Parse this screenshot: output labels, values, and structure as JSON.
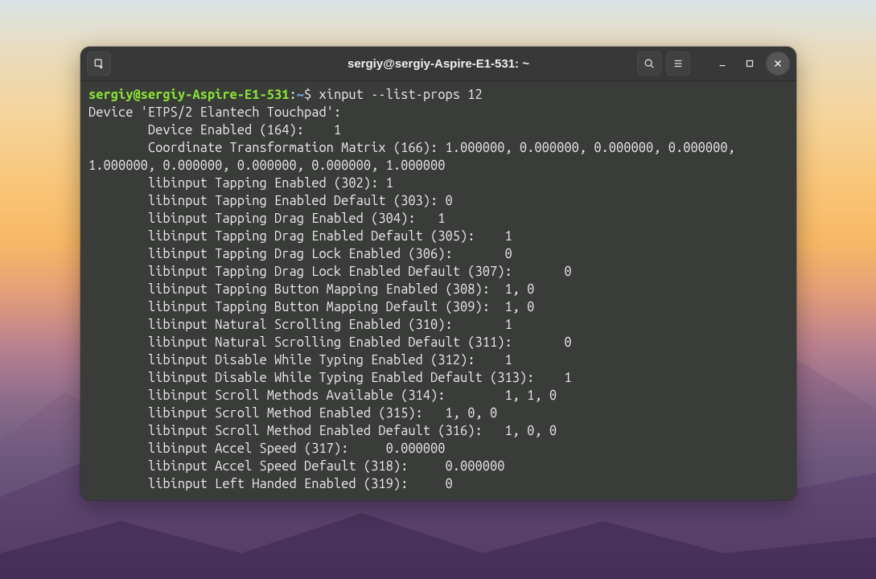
{
  "window": {
    "title": "sergiy@sergiy-Aspire-E1-531: ~"
  },
  "prompt": {
    "user_host": "sergiy@sergiy-Aspire-E1-531",
    "sep": ":",
    "path": "~",
    "sigil": "$",
    "command": "xinput --list-props 12"
  },
  "output": {
    "device_line": "Device 'ETPS/2 Elantech Touchpad':",
    "lines": [
      "        Device Enabled (164):    1",
      "        Coordinate Transformation Matrix (166): 1.000000, 0.000000, 0.000000, 0.000000, 1.000000, 0.000000, 0.000000, 0.000000, 1.000000",
      "        libinput Tapping Enabled (302): 1",
      "        libinput Tapping Enabled Default (303): 0",
      "        libinput Tapping Drag Enabled (304):   1",
      "        libinput Tapping Drag Enabled Default (305):    1",
      "        libinput Tapping Drag Lock Enabled (306):       0",
      "        libinput Tapping Drag Lock Enabled Default (307):       0",
      "        libinput Tapping Button Mapping Enabled (308):  1, 0",
      "        libinput Tapping Button Mapping Default (309):  1, 0",
      "        libinput Natural Scrolling Enabled (310):       1",
      "        libinput Natural Scrolling Enabled Default (311):       0",
      "        libinput Disable While Typing Enabled (312):    1",
      "        libinput Disable While Typing Enabled Default (313):    1",
      "        libinput Scroll Methods Available (314):        1, 1, 0",
      "        libinput Scroll Method Enabled (315):   1, 0, 0",
      "        libinput Scroll Method Enabled Default (316):   1, 0, 0",
      "        libinput Accel Speed (317):     0.000000",
      "        libinput Accel Speed Default (318):     0.000000",
      "        libinput Left Handed Enabled (319):     0"
    ]
  }
}
